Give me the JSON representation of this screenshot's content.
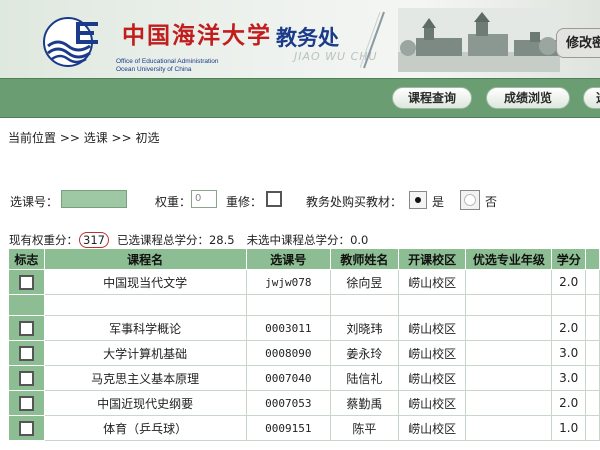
{
  "header": {
    "university_name": "中国海洋大学",
    "english_line1": "Office of Educational Administration",
    "english_line2": "Ocean University of China",
    "dept_name": "教务处",
    "dept_pinyin": "JIAO WU CHU",
    "modify_button": "修改密"
  },
  "nav": {
    "course_query": "课程查询",
    "grade_browse": "成绩浏览",
    "more": "选"
  },
  "breadcrumb": "当前位置 >> 选课 >> 初选",
  "form": {
    "course_id_label": "选课号：",
    "course_id_value": "",
    "weight_label": "权重：",
    "weight_value": "0",
    "retake_label": "重修：",
    "textbook_label": "教务处购买教材：",
    "yes_label": "是",
    "no_label": "否",
    "textbook_selected": "是"
  },
  "summary": {
    "weight_label": "现有权重分：",
    "weight_value": "317",
    "selected_label": "已选课程总学分：",
    "selected_value": "28.5",
    "unselected_label": "未选中课程总学分：",
    "unselected_value": "0.0"
  },
  "table": {
    "headers": [
      "标志",
      "课程名",
      "选课号",
      "教师姓名",
      "开课校区",
      "优选专业年级",
      "学分"
    ],
    "rows": [
      {
        "name": "中国现当代文学",
        "id": "jwjw078",
        "teacher": "徐向昱",
        "campus": "崂山校区",
        "major": "",
        "credit": "2.0"
      },
      {
        "name": "",
        "id": "",
        "teacher": "",
        "campus": "",
        "major": "",
        "credit": ""
      },
      {
        "name": "军事科学概论",
        "id": "0003011",
        "teacher": "刘晓玮",
        "campus": "崂山校区",
        "major": "",
        "credit": "2.0"
      },
      {
        "name": "大学计算机基础",
        "id": "0008090",
        "teacher": "姜永玲",
        "campus": "崂山校区",
        "major": "",
        "credit": "3.0"
      },
      {
        "name": "马克思主义基本原理",
        "id": "0007040",
        "teacher": "陆信礼",
        "campus": "崂山校区",
        "major": "",
        "credit": "3.0"
      },
      {
        "name": "中国近现代史纲要",
        "id": "0007053",
        "teacher": "蔡勤禹",
        "campus": "崂山校区",
        "major": "",
        "credit": "2.0"
      },
      {
        "name": "体育（乒乓球）",
        "id": "0009151",
        "teacher": "陈平",
        "campus": "崂山校区",
        "major": "",
        "credit": "1.0"
      }
    ]
  },
  "colors": {
    "nav_green": "#6a9d72",
    "table_header_green": "#8dbe93",
    "input_green": "#9ec8a4",
    "brand_red": "#c21d1d",
    "brand_blue": "#1a3a8a"
  }
}
